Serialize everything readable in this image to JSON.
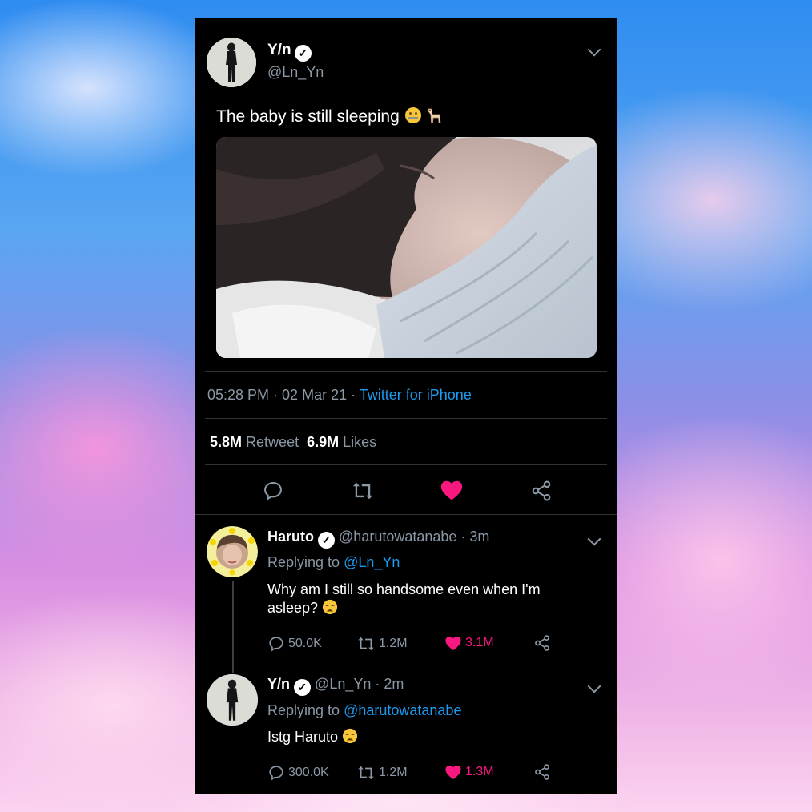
{
  "main_tweet": {
    "author_name": "Y/n",
    "author_handle": "@Ln_Yn",
    "text": "The baby is still sleeping",
    "time": "05:28 PM",
    "date": "02 Mar 21",
    "source": "Twitter for iPhone",
    "retweets_count": "5.8M",
    "retweets_label": "Retweet",
    "likes_count": "6.9M",
    "likes_label": "Likes",
    "liked": true,
    "icons": [
      "reply-icon",
      "retweet-icon",
      "like-icon",
      "share-icon"
    ]
  },
  "replies": [
    {
      "author_name": "Haruto",
      "author_handle": "@harutowatanabe",
      "time_ago": "3m",
      "replying_to_label": "Replying to",
      "replying_to_handle": "@Ln_Yn",
      "text": "Why am I still so handsome even when I'm asleep?",
      "reply_count": "50.0K",
      "retweet_count": "1.2M",
      "like_count": "3.1M"
    },
    {
      "author_name": "Y/n",
      "author_handle": "@Ln_Yn",
      "time_ago": "2m",
      "replying_to_label": "Replying to",
      "replying_to_handle": "@harutowatanabe",
      "text": "Istg Haruto",
      "reply_count": "300.0K",
      "retweet_count": "1.2M",
      "like_count": "1.3M"
    }
  ],
  "colors": {
    "accent_blue": "#1d9bf0",
    "like_red": "#f91880",
    "background": "#000000",
    "muted": "#8b98a5"
  }
}
